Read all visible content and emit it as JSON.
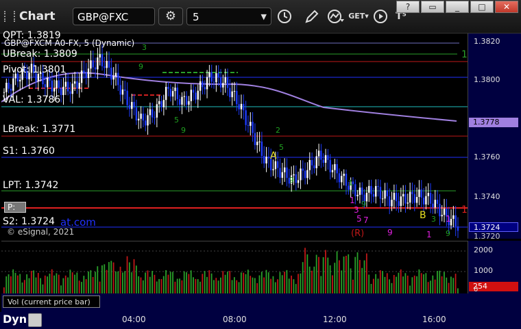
{
  "toolbar": {
    "title": "Chart",
    "symbol": "GBP@FXC",
    "interval": "5",
    "window_buttons": [
      "?",
      "▭",
      "_",
      "□",
      "✕"
    ]
  },
  "chart": {
    "header": "GBP@FXCM A0-FX, 5 (Dynamic)",
    "copyright": "© eSignal, 2021",
    "levels": {
      "qpt": "QPT: 1.3819",
      "ubreak": "UBreak: 1.3809",
      "pivot": "Pivot: 1.3801",
      "val": "VAL: 1.3786",
      "lbreak": "LBreak: 1.3771",
      "s1": "S1: 1.3760",
      "lpt": "LPT: 1.3742",
      "s2": "S2: 1.3724",
      "website_fragment": "at.com",
      "watermark_box": "P:"
    },
    "markers": {
      "a": "A",
      "b": "B",
      "r": "(R)",
      "num_1_green": "1",
      "num_1_red": "1"
    },
    "price_axis": [
      "1.3820",
      "1.3800",
      "1.3778",
      "1.3760",
      "1.3740",
      "1.3724",
      "1.3720"
    ],
    "price_tag_current": "1.3778",
    "price_tag_last": "1.3724",
    "vol_axis": [
      "2000",
      "1000",
      "0"
    ],
    "vol_tag": "254",
    "vol_label": "Vol (current price bar)",
    "time_axis": [
      "04:00",
      "08:00",
      "12:00",
      "16:00"
    ],
    "dyn_label": "Dyn"
  },
  "colors": {
    "up_candle": "#ffffff",
    "down_candle": "#1e3cff",
    "ma_line": "#a080e0",
    "resistance_red": "#d01818",
    "support_blue": "#2030ff",
    "level_green": "#2aa02a"
  },
  "chart_data": {
    "type": "line",
    "title": "GBP@FXCM A0-FX, 5 (Dynamic)",
    "xlabel": "",
    "ylabel": "",
    "ylim": [
      1.372,
      1.3825
    ],
    "x_ticks": [
      "04:00",
      "08:00",
      "12:00",
      "16:00"
    ],
    "series": [
      {
        "values": [
          1.3795,
          1.3803,
          1.3806,
          1.38,
          1.3797,
          1.3797,
          1.3806,
          1.3812,
          1.3803,
          1.379,
          1.378,
          1.3785,
          1.3797,
          1.379,
          1.3795,
          1.3803,
          1.38,
          1.379,
          1.3775,
          1.376,
          1.3755,
          1.375,
          1.3755,
          1.3763,
          1.3755,
          1.3748,
          1.3742,
          1.3745,
          1.374,
          1.374,
          1.3742,
          1.374,
          1.3732,
          1.3727
        ]
      }
    ],
    "volume": {
      "ylim": [
        0,
        2500
      ],
      "last": 254
    }
  }
}
